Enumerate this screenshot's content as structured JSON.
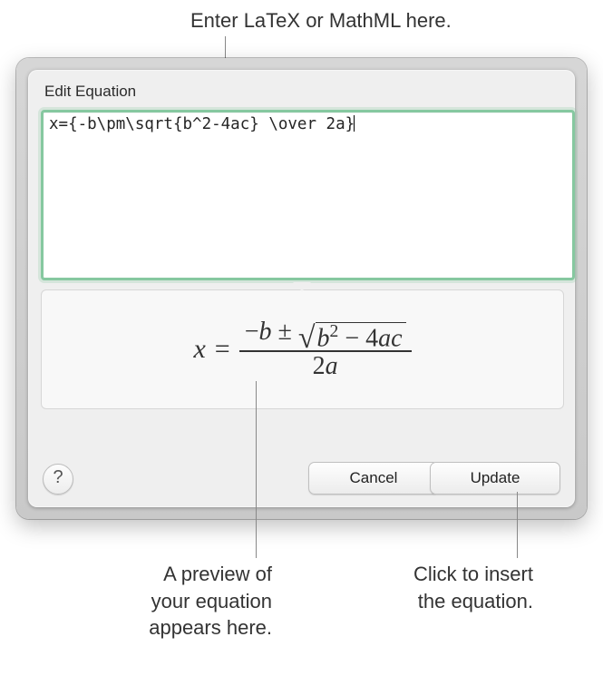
{
  "callouts": {
    "input": "Enter LaTeX or MathML here.",
    "preview": "A preview of\nyour equation\nappears here.",
    "update": "Click to insert\nthe equation."
  },
  "dialog": {
    "title": "Edit Equation",
    "latex_source": "x={-b\\pm\\sqrt{b^2-4ac} \\over 2a}",
    "preview": {
      "lhs_var": "x",
      "numerator_prefix": "−b ±",
      "radicand": "b² − 4ac",
      "denominator": "2a",
      "full_latex": "x = \\frac{-b \\pm \\sqrt{b^2 - 4ac}}{2a}"
    },
    "buttons": {
      "help": "?",
      "cancel": "Cancel",
      "update": "Update"
    }
  }
}
